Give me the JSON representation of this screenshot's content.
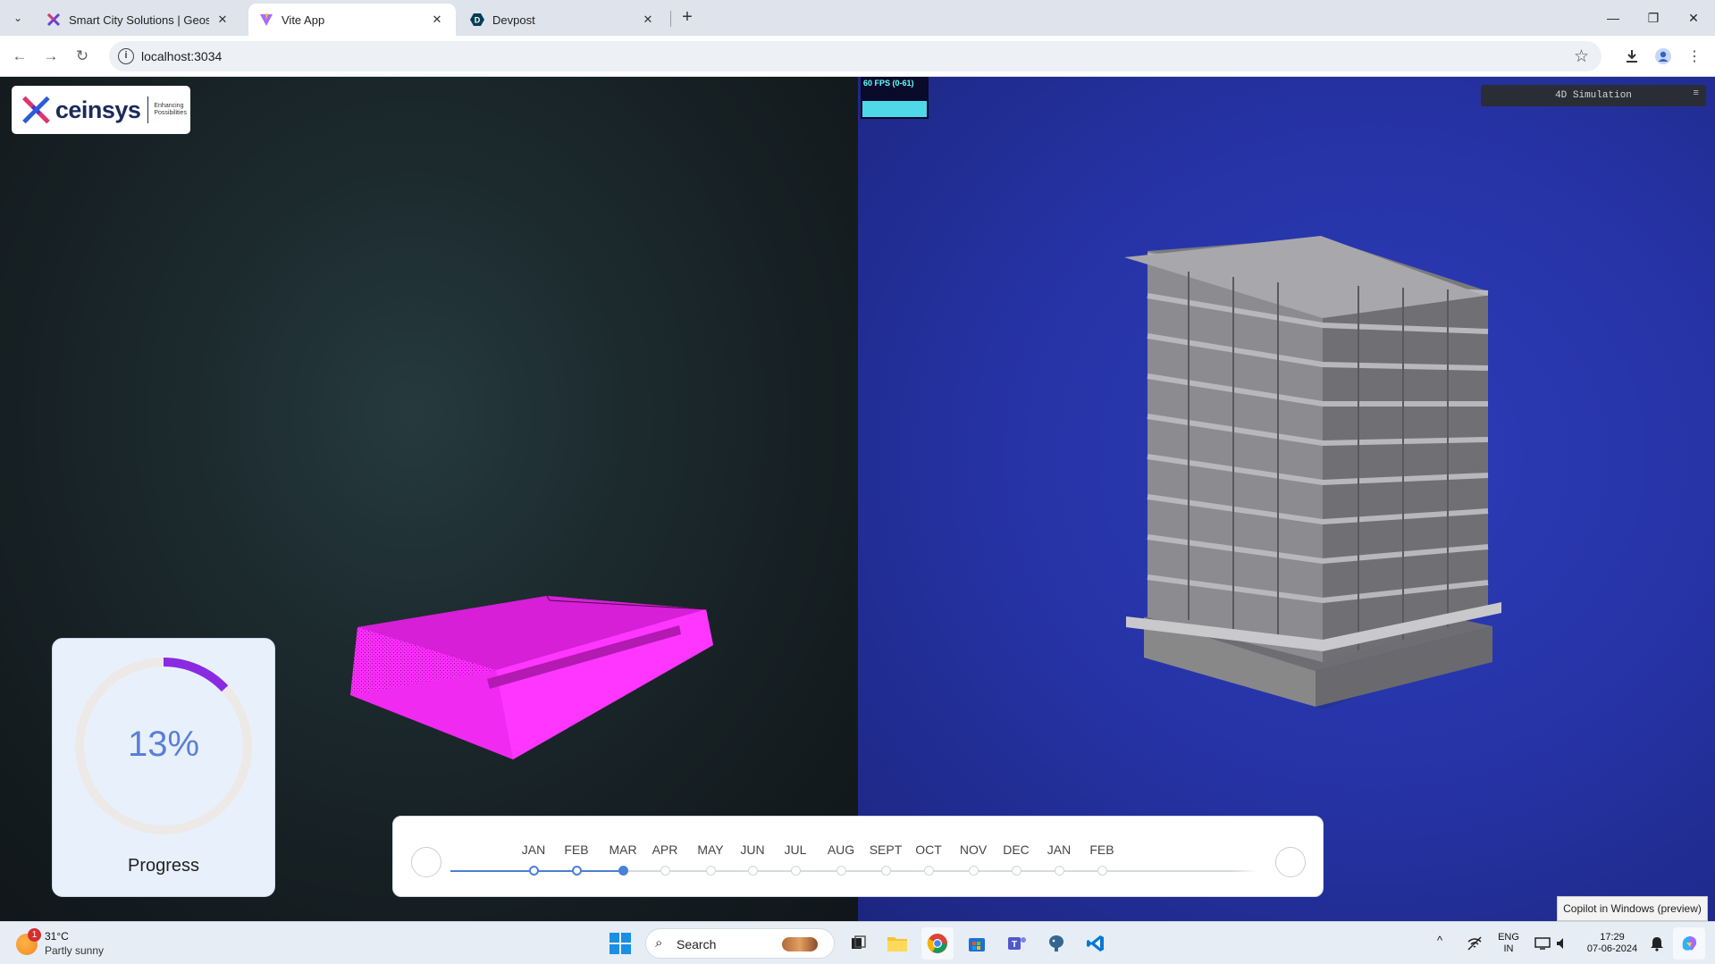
{
  "browser": {
    "tabs": [
      {
        "title": "Smart City Solutions | Geospatia",
        "active": false
      },
      {
        "title": "Vite App",
        "active": true
      },
      {
        "title": "Devpost",
        "active": false
      }
    ],
    "url": "localhost:3034"
  },
  "app": {
    "logo": {
      "word": "ceinsys",
      "tagline": "Enhancing Possibilities"
    },
    "fps_label": "60 FPS (0-61)",
    "simulation_select": "4D Simulation",
    "progress": {
      "percent_text": "13%",
      "value": 0.13,
      "label": "Progress"
    },
    "timeline": {
      "months": [
        "JAN",
        "FEB",
        "MAR",
        "APR",
        "MAY",
        "JUN",
        "JUL",
        "AUG",
        "SEPT",
        "OCT",
        "NOV",
        "DEC",
        "JAN",
        "FEB"
      ],
      "current_index": 2
    },
    "colors": {
      "accent": "#4c7fd9",
      "progress_arc": "#8a2be2",
      "pointcloud": "#ff2cff"
    }
  },
  "tooltip": "Copilot in Windows (preview)",
  "taskbar": {
    "weather": {
      "temp": "31°C",
      "desc": "Partly sunny",
      "badge": "1"
    },
    "search_label": "Search",
    "lang_line1": "ENG",
    "lang_line2": "IN",
    "time": "17:29",
    "date": "07-06-2024"
  }
}
